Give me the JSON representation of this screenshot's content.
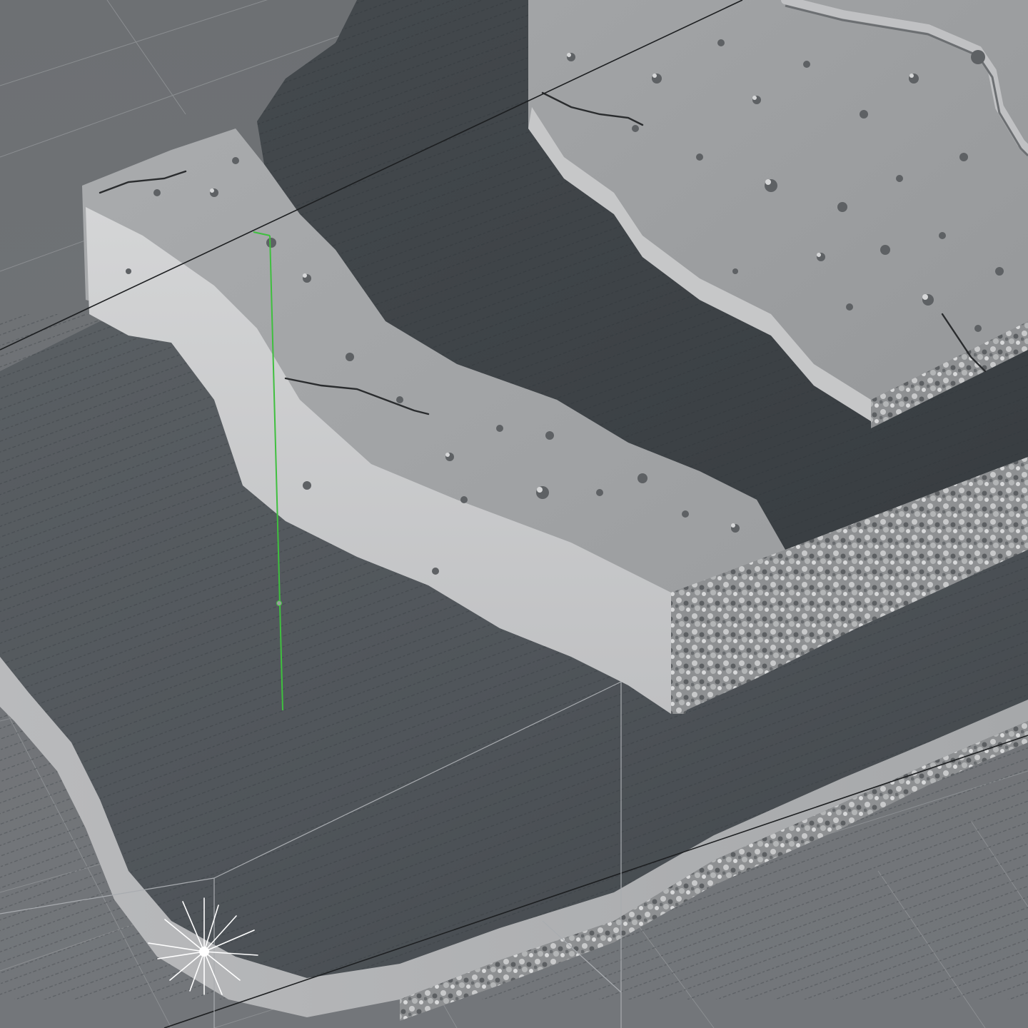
{
  "viewport": {
    "background_color": "#6f7275",
    "grid_color": "#8b8e91",
    "top_slab_color": "#9fa1a3",
    "top_slab_side_color": "#c9cacb",
    "mid_slab_color": "#a4a6a8",
    "mid_slab_side_color": "#cdcecf",
    "lower_layer_color": "#4f5458",
    "lower_layer_dark_color": "#3c4145",
    "axis_line_color": "#1d1f21",
    "vertical_guide_color": "#3fbf3f",
    "light_icon_color": "#ffffff"
  },
  "icons": {
    "light": "light-star-icon",
    "guide": "green-axis-guide"
  }
}
